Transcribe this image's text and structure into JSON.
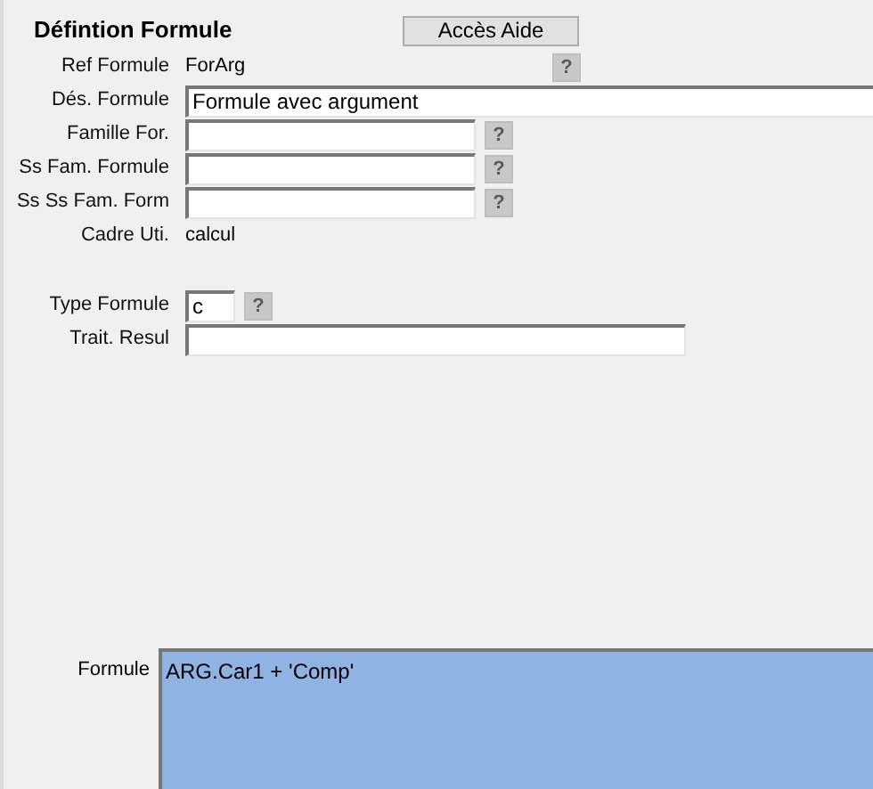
{
  "title": "Défintion Formule",
  "help_button": {
    "label": "Accès Aide"
  },
  "sections": [
    [
      {
        "label": "Ref Formule",
        "kind": "value",
        "value": "ForArg",
        "help": "?"
      },
      {
        "label": "Dés. Formule",
        "kind": "input-wide",
        "value": "Formule avec argument"
      },
      {
        "label": "Famille For.",
        "kind": "input",
        "help": "?"
      },
      {
        "label": "Ss Fam. Formule",
        "kind": "input",
        "help": "?"
      },
      {
        "label": "Ss Ss Fam. Form",
        "kind": "input",
        "help": "?"
      },
      {
        "label": "Cadre Uti.",
        "kind": "value",
        "value": "calcul"
      }
    ],
    [
      {
        "label": "Type Formule",
        "kind": "input-short",
        "value": "c",
        "help": "?"
      },
      {
        "label": "Trait. Resul",
        "kind": "input-long"
      }
    ]
  ],
  "formula": {
    "label": "Formule",
    "value": "ARG.Car1 + 'Comp'",
    "selected": true
  }
}
